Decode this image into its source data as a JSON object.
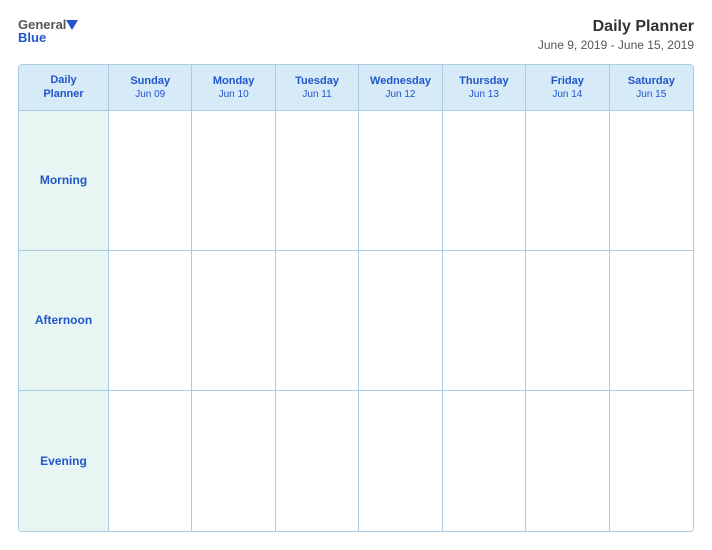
{
  "header": {
    "logo_general": "General",
    "logo_blue": "Blue",
    "title": "Daily Planner",
    "subtitle": "June 9, 2019 - June 15, 2019"
  },
  "calendar": {
    "header": [
      {
        "day": "Daily",
        "day2": "Planner",
        "date": ""
      },
      {
        "day": "Sunday",
        "date": "Jun 09"
      },
      {
        "day": "Monday",
        "date": "Jun 10"
      },
      {
        "day": "Tuesday",
        "date": "Jun 11"
      },
      {
        "day": "Wednesday",
        "date": "Jun 12"
      },
      {
        "day": "Thursday",
        "date": "Jun 13"
      },
      {
        "day": "Friday",
        "date": "Jun 14"
      },
      {
        "day": "Saturday",
        "date": "Jun 15"
      }
    ],
    "rows": [
      {
        "label": "Morning"
      },
      {
        "label": "Afternoon"
      },
      {
        "label": "Evening"
      }
    ]
  }
}
